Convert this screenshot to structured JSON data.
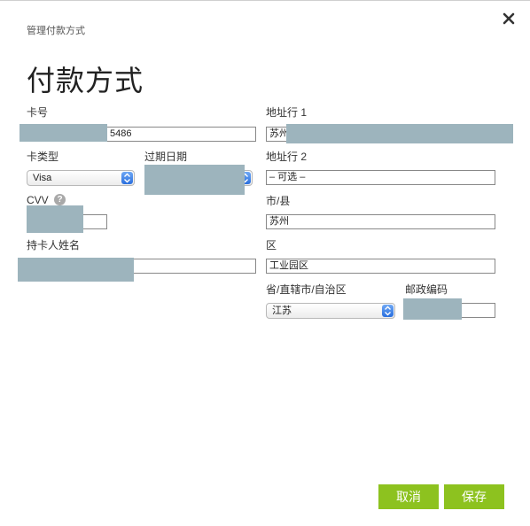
{
  "dialog": {
    "header": "管理付款方式",
    "title": "付款方式"
  },
  "form": {
    "card_number": {
      "label": "卡号",
      "value": "5486"
    },
    "card_type": {
      "label": "卡类型",
      "selected": "Visa"
    },
    "expiry": {
      "label": "过期日期"
    },
    "cvv": {
      "label": "CVV",
      "help_glyph": "?"
    },
    "cardholder": {
      "label": "持卡人姓名"
    },
    "address1": {
      "label": "地址行 1",
      "value": "苏州"
    },
    "address2": {
      "label": "地址行 2",
      "placeholder": "– 可选 –"
    },
    "city": {
      "label": "市/县",
      "value": "苏州"
    },
    "district": {
      "label": "区",
      "value": "工业园区"
    },
    "province": {
      "label": "省/直辖市/自治区",
      "selected": "江苏"
    },
    "postal": {
      "label": "邮政编码"
    }
  },
  "buttons": {
    "cancel": "取消",
    "save": "保存"
  },
  "colors": {
    "accent": "#8dc21f",
    "redaction": "#9db4bd"
  },
  "icons": {
    "close": "close-icon",
    "help": "help-icon",
    "select_arrow": "chevron-updown-icon"
  }
}
